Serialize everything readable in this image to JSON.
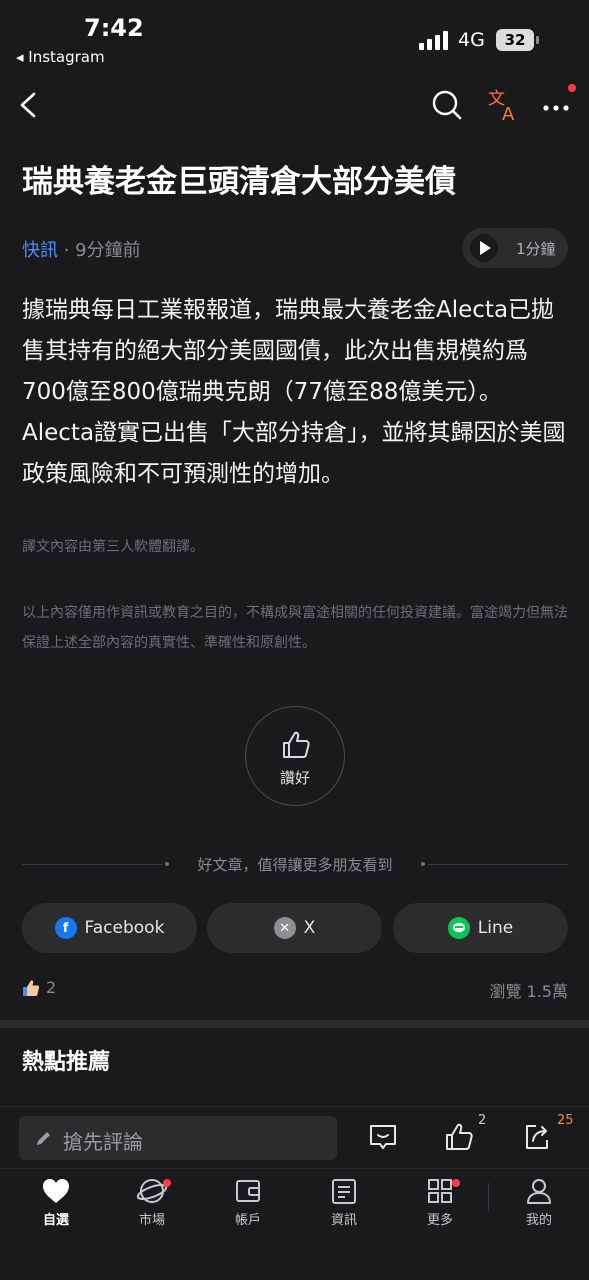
{
  "status": {
    "time": "7:42",
    "back_app": "◂ Instagram",
    "network": "4G",
    "battery": "32"
  },
  "article": {
    "title": "瑞典養老金巨頭清倉大部分美債",
    "source": "快訊",
    "separator": " · ",
    "published": "9分鐘前",
    "audio_duration": "1分鐘",
    "body": "據瑞典每日工業報報道，瑞典最大養老金Alecta已拋售其持有的絕大部分美國國債，此次出售規模約爲700億至800億瑞典克朗（77億至88億美元）。Alecta證實已出售「大部分持倉」，並將其歸因於美國政策風險和不可預測性的增加。",
    "translation_note": "譯文內容由第三人軟體翻譯。",
    "disclaimer": "以上內容僅用作資訊或教育之目的，不構成與富途相關的任何投資建議。富途竭力但無法保證上述全部內容的真實性、準確性和原創性。",
    "like_label": "讚好"
  },
  "share": {
    "prompt": "好文章，值得讓更多朋友看到",
    "buttons": [
      {
        "label": "Facebook",
        "icon": "facebook-icon",
        "color": "#1877f2"
      },
      {
        "label": "X",
        "icon": "x-icon",
        "color": "#8e8e93"
      },
      {
        "label": "Line",
        "icon": "line-icon",
        "color": "#06c755"
      }
    ]
  },
  "stats": {
    "likes": "2",
    "views": "瀏覽 1.5萬"
  },
  "section": {
    "title": "熱點推薦"
  },
  "comment_bar": {
    "placeholder": "搶先評論",
    "like_count": "2",
    "share_count": "25"
  },
  "tabbar": {
    "items": [
      {
        "label": "自選",
        "icon": "heart-icon"
      },
      {
        "label": "市場",
        "icon": "planet-icon"
      },
      {
        "label": "帳戶",
        "icon": "wallet-icon"
      },
      {
        "label": "資訊",
        "icon": "news-icon"
      },
      {
        "label": "更多",
        "icon": "grid-icon"
      },
      {
        "label": "我的",
        "icon": "user-icon"
      }
    ]
  },
  "colors": {
    "background": "#1a1a1c",
    "accent": "#4a8ff7",
    "badge": "#ff3b4a",
    "share_count": "#ff8a1f",
    "translate_icon": "#ff7a2a"
  }
}
